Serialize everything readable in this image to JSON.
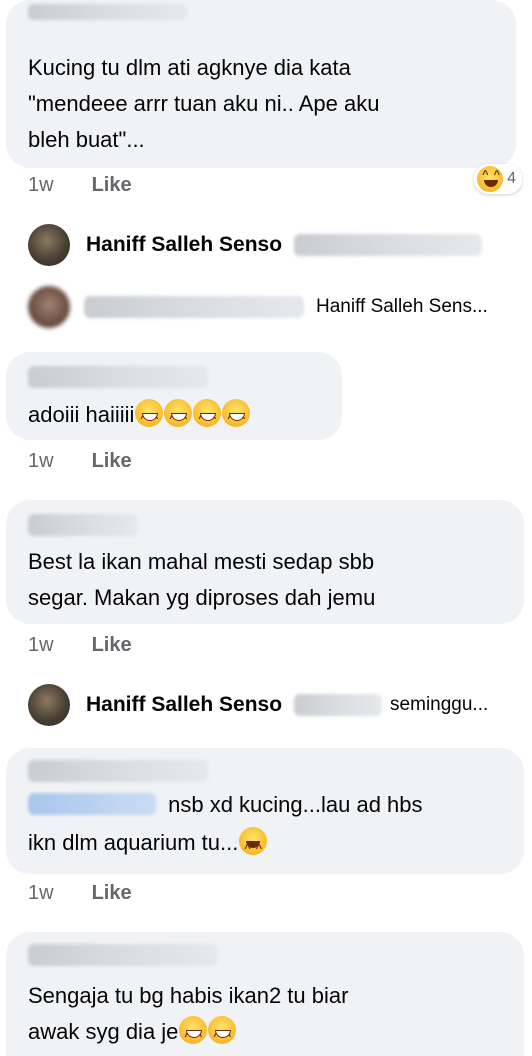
{
  "comments": [
    {
      "lines": "Kucing tu dlm ati agknye dia kata\n\"mendeee arrr tuan aku ni.. Ape aku\nbleh buat\"...",
      "time": "1w",
      "like": "Like",
      "reaction_count": "4"
    },
    {
      "text": "adoiii haiiiii",
      "time": "1w",
      "like": "Like"
    },
    {
      "lines": "Best la ikan mahal mesti sedap sbb\nsegar.  Makan yg diproses dah jemu",
      "time": "1w",
      "like": "Like"
    },
    {
      "text": "nsb xd kucing...lau ad hbs",
      "text2": "ikn dlm aquarium tu...",
      "time": "1w",
      "like": "Like"
    },
    {
      "line1": "Sengaja tu bg habis ikan2 tu biar",
      "line2": "awak syg dia je"
    }
  ],
  "replies": [
    {
      "name": "Haniff Salleh Senso"
    },
    {
      "preview": "Haniff Salleh Sens..."
    },
    {
      "name": "Haniff Salleh Senso",
      "preview": "seminggu..."
    }
  ],
  "icons": {
    "reaction": "haha-emoji-icon",
    "grin": "grinning-emoji-icon"
  }
}
